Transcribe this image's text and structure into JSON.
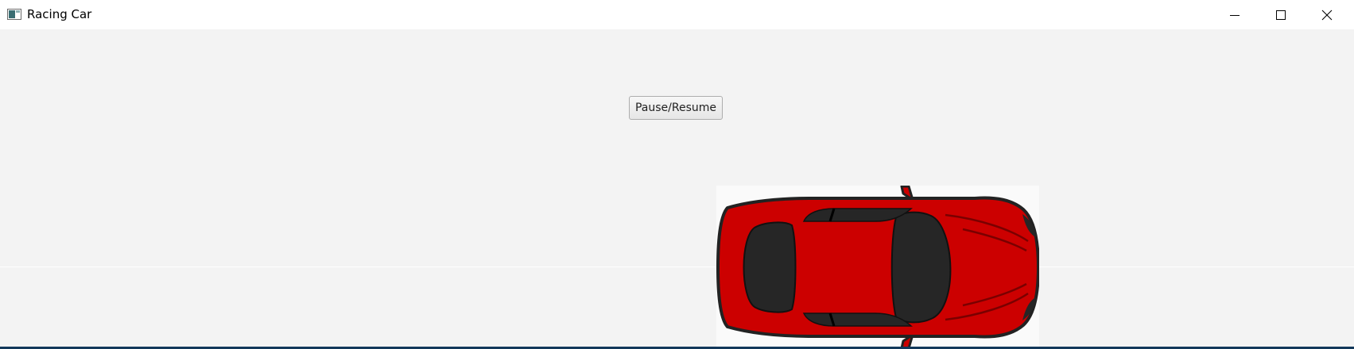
{
  "window": {
    "title": "Racing Car",
    "controls": {
      "minimize": "minimize-icon",
      "maximize": "maximize-icon",
      "close": "close-icon"
    }
  },
  "main": {
    "pause_button_label": "Pause/Resume"
  },
  "car": {
    "icon": "racing-car-icon",
    "body_color": "#cc0000",
    "glass_color": "#262626"
  }
}
